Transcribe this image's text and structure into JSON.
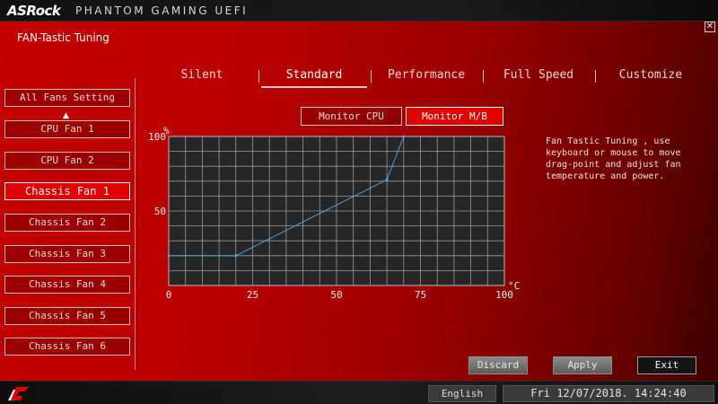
{
  "header": {
    "brand": "ASRock",
    "product": "PHANTOM GAMING UEFI",
    "close_symbol": "✕"
  },
  "page_title": "FAN-Tastic Tuning",
  "sidebar": {
    "items": [
      {
        "label": "All Fans Setting",
        "active": false
      },
      {
        "label": "CPU Fan 1",
        "active": false
      },
      {
        "label": "CPU Fan 2",
        "active": false
      },
      {
        "label": "Chassis Fan 1",
        "active": true
      },
      {
        "label": "Chassis Fan 2",
        "active": false
      },
      {
        "label": "Chassis Fan 3",
        "active": false
      },
      {
        "label": "Chassis Fan 4",
        "active": false
      },
      {
        "label": "Chassis Fan 5",
        "active": false
      },
      {
        "label": "Chassis Fan 6",
        "active": false
      }
    ]
  },
  "tabs": [
    {
      "label": "Silent",
      "active": false
    },
    {
      "label": "Standard",
      "active": true
    },
    {
      "label": "Performance",
      "active": false
    },
    {
      "label": "Full Speed",
      "active": false
    },
    {
      "label": "Customize",
      "active": false
    }
  ],
  "monitor": {
    "cpu_label": "Monitor CPU",
    "mb_label": "Monitor M/B",
    "selected": "Monitor M/B"
  },
  "help_text": "Fan Tastic Tuning , use keyboard or mouse to move drag-point and adjust fan temperature and power.",
  "actions": {
    "discard": "Discard",
    "apply": "Apply",
    "exit": "Exit"
  },
  "footer": {
    "language": "English",
    "datetime": "Fri 12/07/2018. 14:24:40"
  },
  "colors": {
    "accent": "#e00000",
    "curve": "#4fa3e0",
    "grid": "#9a9a9a",
    "chart_bg": "#262626"
  },
  "chart_data": {
    "type": "line",
    "xlabel": "°C",
    "ylabel": "%",
    "xlim": [
      0,
      100
    ],
    "ylim": [
      0,
      100
    ],
    "x_ticks": [
      "0",
      "25",
      "50",
      "75",
      "100"
    ],
    "y_ticks": [
      "50",
      "100"
    ],
    "grid": true,
    "series": [
      {
        "x": [
          0,
          20,
          65,
          70
        ],
        "y": [
          20,
          20,
          71,
          100
        ]
      }
    ]
  }
}
